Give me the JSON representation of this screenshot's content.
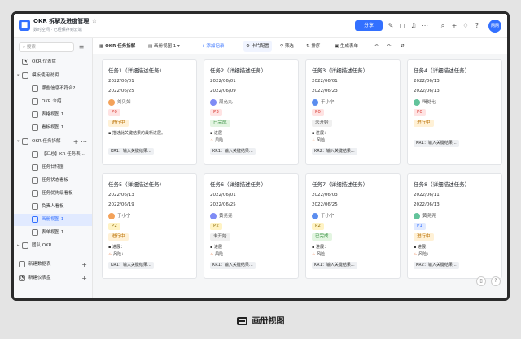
{
  "header": {
    "doc_title": "OKR 拆解及进度管理",
    "doc_sub": "数时空间 · 已经保存到云端",
    "share_label": "分享",
    "avatar_text": "网网"
  },
  "sidebar": {
    "search_placeholder": "搜索",
    "items": [
      {
        "label": "OKR 仪表盘"
      },
      {
        "label": "模板使用说明"
      },
      {
        "label": "哪些信息不符合?"
      },
      {
        "label": "OKR 介绍"
      },
      {
        "label": "表格视图 1"
      },
      {
        "label": "看板视图 1"
      },
      {
        "label": "OKR 任务拆解"
      },
      {
        "label": "【汇总】KR 任务表..."
      },
      {
        "label": "任务甘特图"
      },
      {
        "label": "任务状态看板"
      },
      {
        "label": "任务优先级看板"
      },
      {
        "label": "负责人看板"
      },
      {
        "label": "画册视图 1"
      },
      {
        "label": "表单视图 1"
      },
      {
        "label": "团队 OKR"
      },
      {
        "label": "新建数据表"
      },
      {
        "label": "新建仪表盘"
      }
    ]
  },
  "toolbar": {
    "table_name": "OKR 任务拆解",
    "view_name": "画册视图 1",
    "add_record": "+ 添加记录",
    "card_config": "卡片配置",
    "filter": "筛选",
    "sort": "排序",
    "generate_form": "生成表单"
  },
  "cards": [
    {
      "title": "任务1（详细描述任务）",
      "start": "2022/06/01",
      "end": "2022/06/25",
      "user": "刘贝如",
      "priority": "P0",
      "status": "进行中",
      "line1": "描述此关键结果的最新进展。",
      "line2": "",
      "kr": "KR1：输入关键结果..."
    },
    {
      "title": "任务2（详细描述任务）",
      "start": "2022/06/01",
      "end": "2022/06/09",
      "user": "周允丸",
      "priority": "P3",
      "status": "已完成",
      "line1": "进展",
      "line2": "风险",
      "kr": "KR1：输入关键结果..."
    },
    {
      "title": "任务3（详细描述任务）",
      "start": "2022/06/01",
      "end": "2022/06/23",
      "user": "于小宁",
      "priority": "P0",
      "status": "未开始",
      "line1": "进展：",
      "line2": "风险：",
      "kr": "KR2：输入关键结果..."
    },
    {
      "title": "任务4（详细描述任务）",
      "start": "2022/06/13",
      "end": "2022/06/13",
      "user": "喝处七",
      "priority": "P0",
      "status": "进行中",
      "line1": "",
      "line2": "",
      "kr": "KR1：输入关键结果..."
    },
    {
      "title": "任务5（详细描述任务）",
      "start": "2022/06/13",
      "end": "2022/06/19",
      "user": "于小宁",
      "priority": "P2",
      "status": "进行中",
      "line1": "进展：",
      "line2": "风险：",
      "kr": "KR1：输入关键结果..."
    },
    {
      "title": "任务6（详细描述任务）",
      "start": "2022/06/01",
      "end": "2022/06/25",
      "user": "黄尧尧",
      "priority": "P2",
      "status": "未开始",
      "line1": "进展",
      "line2": "风险",
      "kr": "KR1：输入关键结果..."
    },
    {
      "title": "任务7（详细描述任务）",
      "start": "2022/06/03",
      "end": "2022/06/25",
      "user": "于小宁",
      "priority": "P2",
      "status": "已完成",
      "line1": "进展：",
      "line2": "风险：",
      "kr": "KR1：输入关键结果..."
    },
    {
      "title": "任务8（详细描述任务）",
      "start": "2022/06/11",
      "end": "2022/06/13",
      "user": "黄尧尧",
      "priority": "P1",
      "status": "进行中",
      "line1": "进展：",
      "line2": "风险：",
      "kr": "KR2：输入关键结果..."
    }
  ],
  "caption": "画册视图",
  "colors": {
    "accent": "#3370ff",
    "status_doing": "#fff3d6",
    "status_done": "#e3f5e1",
    "status_todo": "#ffe8e8"
  },
  "icons": [
    "star-icon",
    "search-icon",
    "plus-icon",
    "bell-icon",
    "more-icon",
    "grid-icon",
    "table-icon",
    "filter-icon",
    "sort-icon",
    "undo-icon",
    "redo-icon"
  ]
}
